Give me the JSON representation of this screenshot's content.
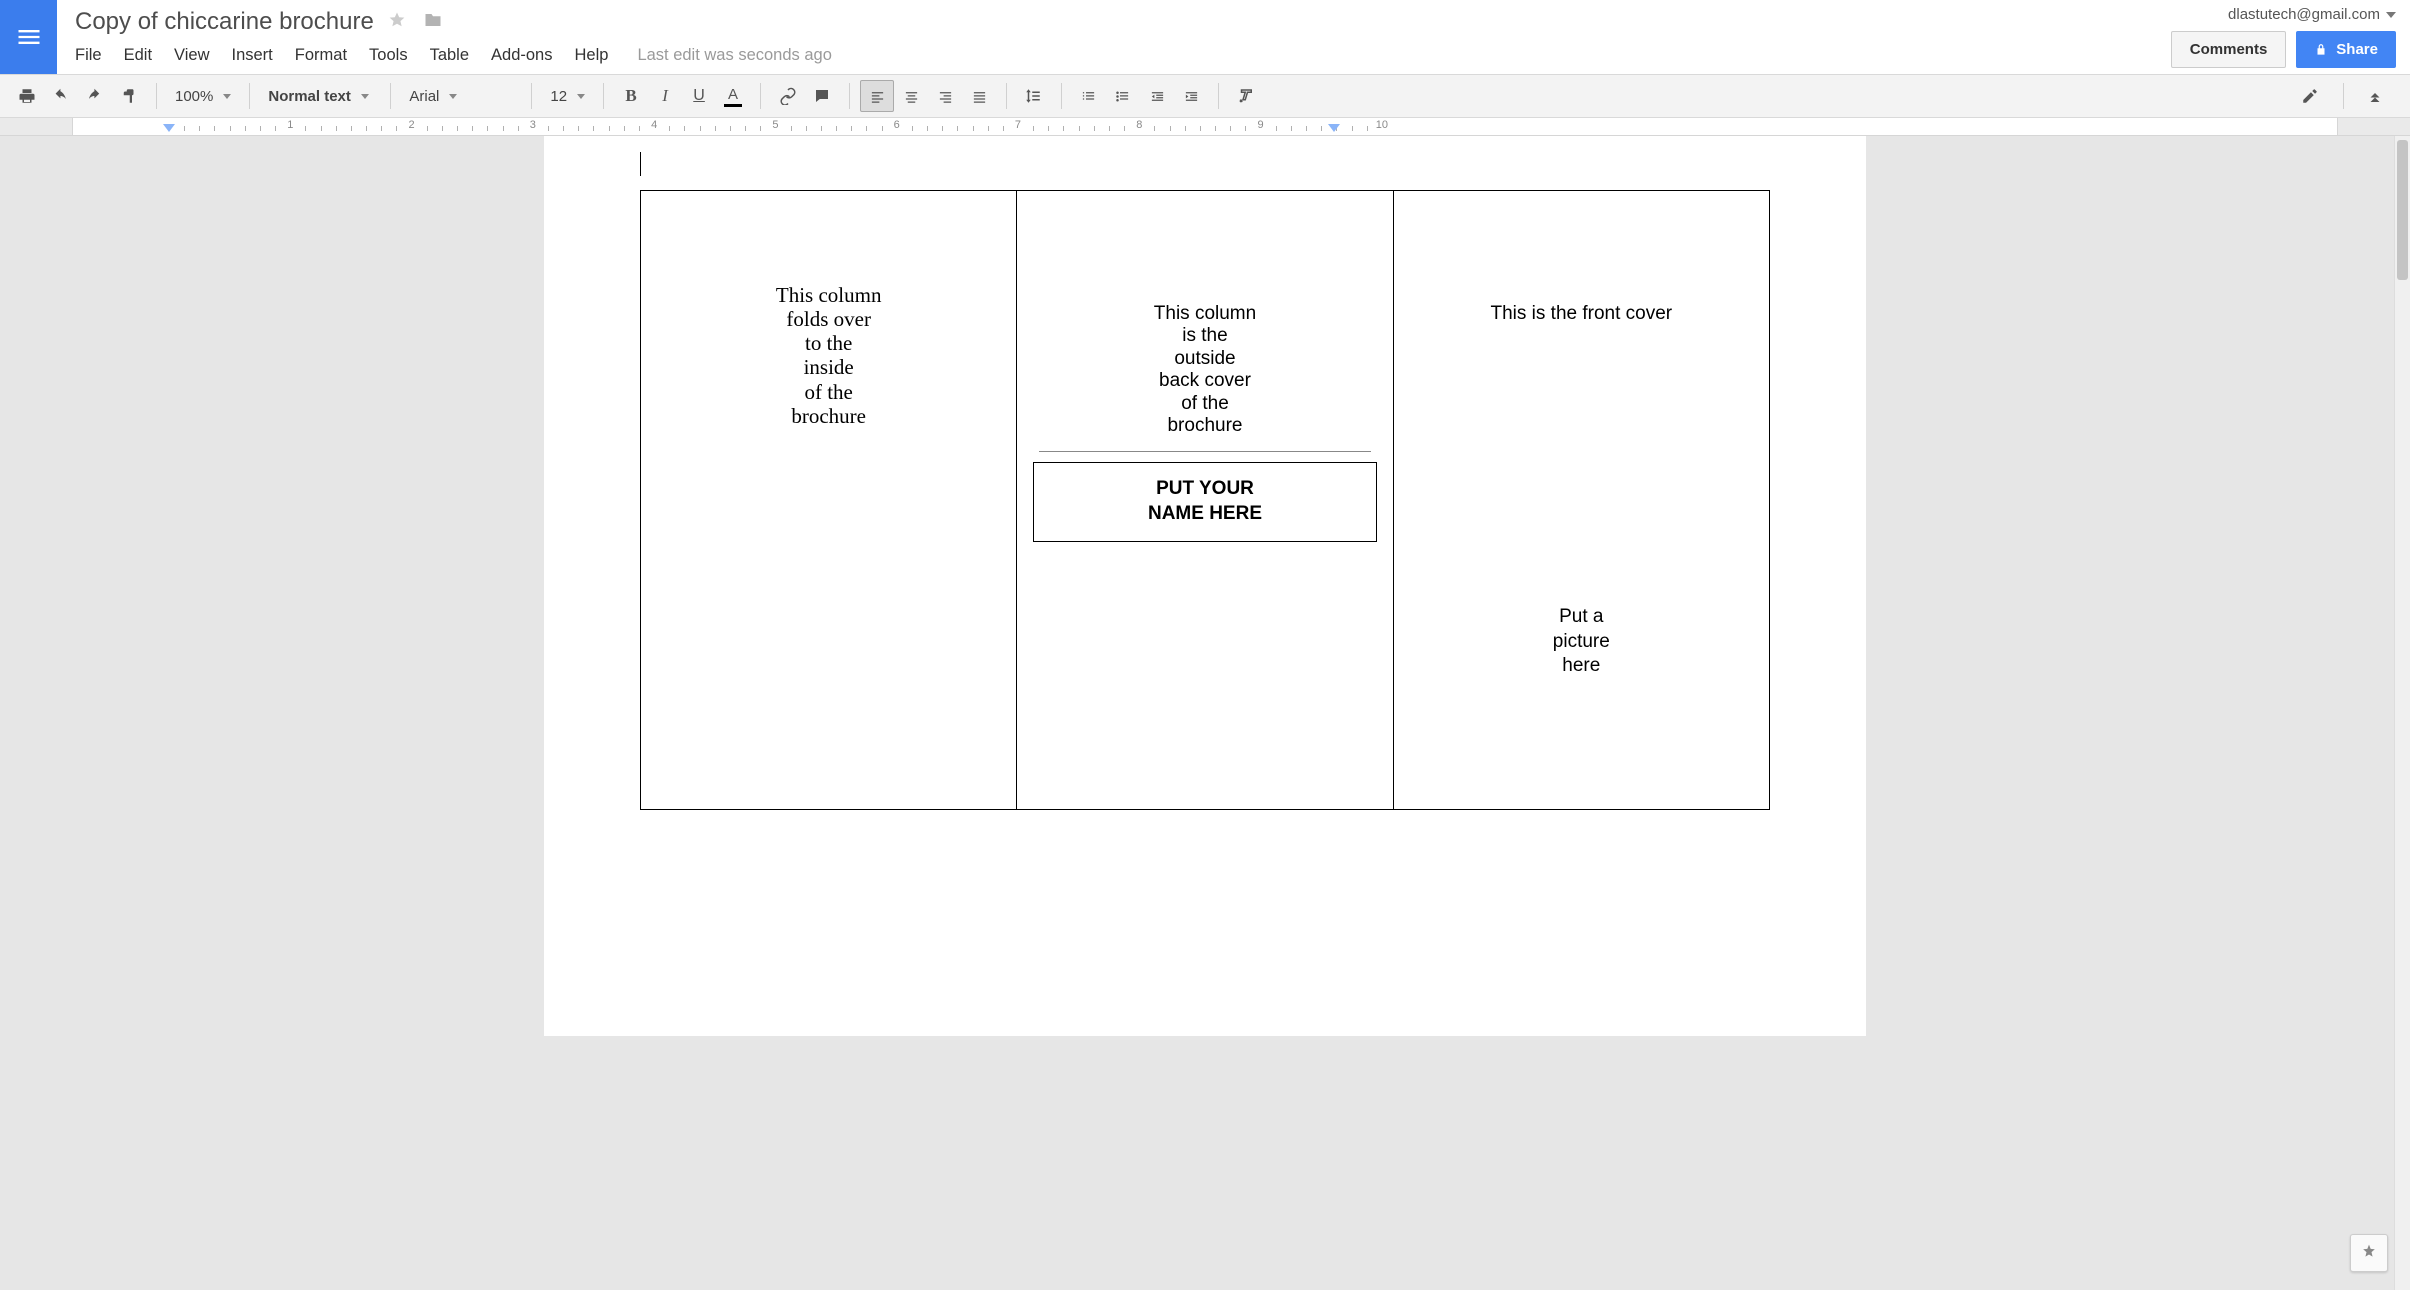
{
  "header": {
    "doc_title": "Copy of chiccarine brochure",
    "account_email": "dlastutech@gmail.com",
    "comments_label": "Comments",
    "share_label": "Share",
    "last_edit": "Last edit was seconds ago"
  },
  "menu": [
    "File",
    "Edit",
    "View",
    "Insert",
    "Format",
    "Tools",
    "Table",
    "Add-ons",
    "Help"
  ],
  "toolbar": {
    "zoom": "100%",
    "style": "Normal text",
    "font": "Arial",
    "font_size": "12"
  },
  "ruler": {
    "numbers": [
      1,
      2,
      3,
      4,
      5,
      6,
      7,
      8,
      9,
      10
    ]
  },
  "document": {
    "panel1": "This column\nfolds over\nto the\ninside\nof the\nbrochure",
    "panel2_text": "This column\nis the\noutside\nback cover\nof the\nbrochure",
    "panel2_box": "PUT YOUR\nNAME HERE",
    "panel3_title": "This is the front cover",
    "panel3_pic": "Put a\npicture\nhere"
  }
}
